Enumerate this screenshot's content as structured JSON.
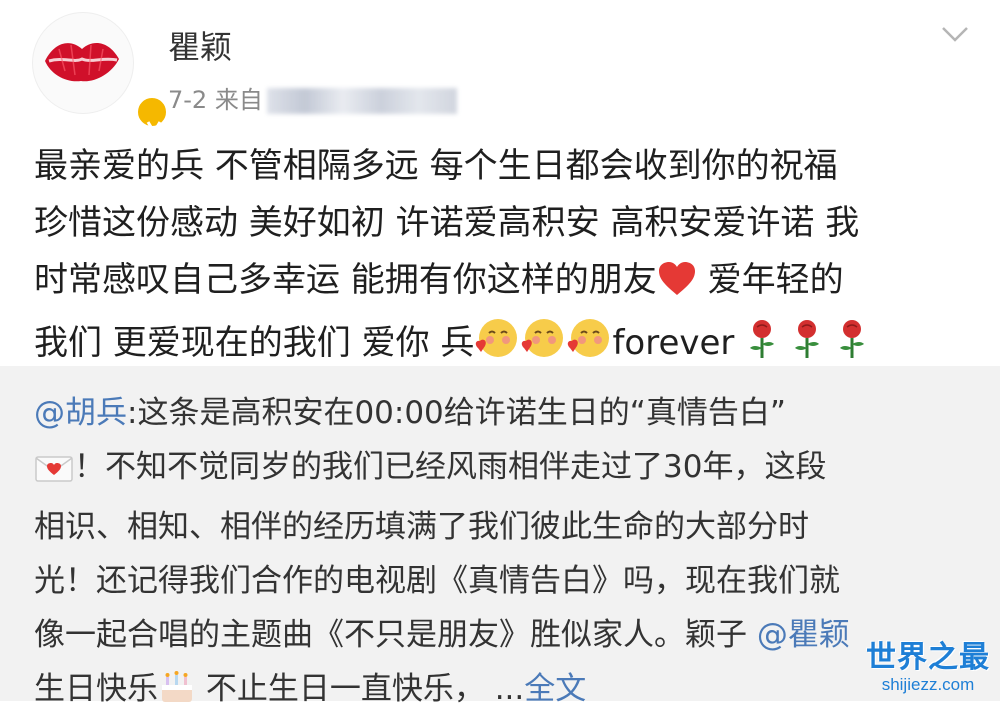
{
  "post": {
    "username": "瞿颖",
    "date": "7-2",
    "source_prefix": "来自",
    "lines": [
      "最亲爱的兵 不管相隔多远 每个生日都会收到你的祝福",
      "珍惜这份感动 美好如初 许诺爱高积安 高积安爱许诺 我",
      "时常感叹自己多幸运 能拥有你这样的朋友",
      "爱年轻的",
      "我们 更爱现在的我们 爱你 兵",
      "forever"
    ]
  },
  "repost": {
    "mention": "@胡兵",
    "line1": ":这条是高积安在00:00给许诺生日的“真情告白”",
    "line2": "！不知不觉同岁的我们已经风雨相伴走过了30年，这段",
    "line3": "相识、相知、相伴的经历填满了我们彼此生命的大部分时",
    "line4": "光！还记得我们合作的电视剧《真情告白》吗，现在我们就",
    "line5": "像一起合唱的主题曲《不只是朋友》胜似家人。颖子",
    "mention2": "@瞿颖",
    "line6a": "生日快乐",
    "line6b": " 不止生日一直快乐，  ...",
    "more_link": "全文"
  },
  "watermark": {
    "main": "世界之最",
    "sub": "shijiezz.com"
  },
  "icons": [
    "lips-avatar",
    "verified-badge",
    "chevron-down-icon",
    "heart-emoji",
    "blush-emoji",
    "rose-emoji",
    "love-letter-emoji",
    "cake-emoji"
  ],
  "colors": {
    "link": "#4b7ab8",
    "verified": "#f5b800",
    "watermark": "#1e7fd6"
  }
}
